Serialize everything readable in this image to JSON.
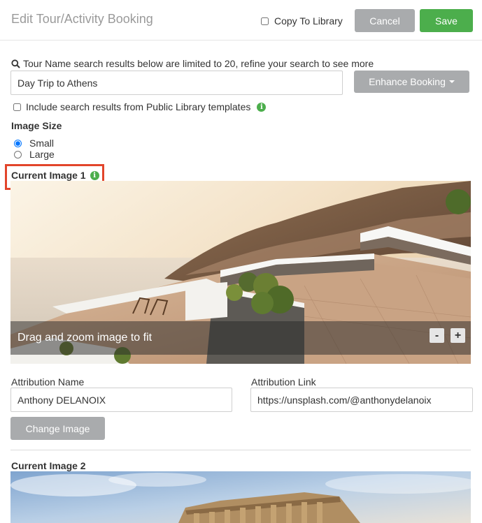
{
  "header": {
    "title": "Edit Tour/Activity Booking",
    "copy_to_library_label": "Copy To Library",
    "copy_to_library_checked": false,
    "cancel_label": "Cancel",
    "save_label": "Save"
  },
  "search": {
    "note": "Tour Name search results below are limited to 20, refine your search to see more",
    "tour_name_value": "Day Trip to Athens",
    "enhance_label": "Enhance Booking",
    "include_public_label": "Include search results from Public Library templates",
    "include_public_checked": false
  },
  "image_size": {
    "label": "Image Size",
    "options": [
      "Small",
      "Large"
    ],
    "selected": "Small"
  },
  "image1": {
    "label": "Current Image 1",
    "overlay_text": "Drag and zoom image to fit",
    "zoom_out": "-",
    "zoom_in": "+",
    "attribution_name_label": "Attribution Name",
    "attribution_name_value": "Anthony DELANOIX",
    "attribution_link_label": "Attribution Link",
    "attribution_link_value": "https://unsplash.com/@anthonydelanoix",
    "change_image_label": "Change Image"
  },
  "image2": {
    "label": "Current Image 2"
  },
  "colors": {
    "save": "#4cae4c",
    "cancel": "#a9abad",
    "highlight": "#e2452b",
    "info": "#4cae4c"
  }
}
